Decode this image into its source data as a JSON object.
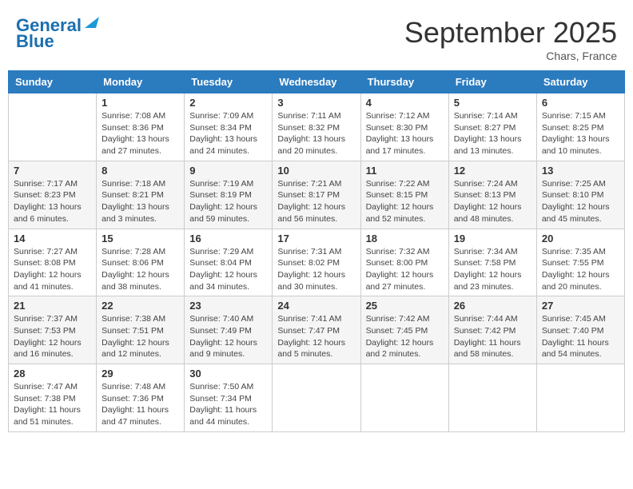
{
  "header": {
    "logo_line1": "General",
    "logo_line2": "Blue",
    "month_title": "September 2025",
    "location": "Chars, France"
  },
  "weekdays": [
    "Sunday",
    "Monday",
    "Tuesday",
    "Wednesday",
    "Thursday",
    "Friday",
    "Saturday"
  ],
  "weeks": [
    [
      {
        "day": null,
        "sunrise": null,
        "sunset": null,
        "daylight": null
      },
      {
        "day": "1",
        "sunrise": "Sunrise: 7:08 AM",
        "sunset": "Sunset: 8:36 PM",
        "daylight": "Daylight: 13 hours and 27 minutes."
      },
      {
        "day": "2",
        "sunrise": "Sunrise: 7:09 AM",
        "sunset": "Sunset: 8:34 PM",
        "daylight": "Daylight: 13 hours and 24 minutes."
      },
      {
        "day": "3",
        "sunrise": "Sunrise: 7:11 AM",
        "sunset": "Sunset: 8:32 PM",
        "daylight": "Daylight: 13 hours and 20 minutes."
      },
      {
        "day": "4",
        "sunrise": "Sunrise: 7:12 AM",
        "sunset": "Sunset: 8:30 PM",
        "daylight": "Daylight: 13 hours and 17 minutes."
      },
      {
        "day": "5",
        "sunrise": "Sunrise: 7:14 AM",
        "sunset": "Sunset: 8:27 PM",
        "daylight": "Daylight: 13 hours and 13 minutes."
      },
      {
        "day": "6",
        "sunrise": "Sunrise: 7:15 AM",
        "sunset": "Sunset: 8:25 PM",
        "daylight": "Daylight: 13 hours and 10 minutes."
      }
    ],
    [
      {
        "day": "7",
        "sunrise": "Sunrise: 7:17 AM",
        "sunset": "Sunset: 8:23 PM",
        "daylight": "Daylight: 13 hours and 6 minutes."
      },
      {
        "day": "8",
        "sunrise": "Sunrise: 7:18 AM",
        "sunset": "Sunset: 8:21 PM",
        "daylight": "Daylight: 13 hours and 3 minutes."
      },
      {
        "day": "9",
        "sunrise": "Sunrise: 7:19 AM",
        "sunset": "Sunset: 8:19 PM",
        "daylight": "Daylight: 12 hours and 59 minutes."
      },
      {
        "day": "10",
        "sunrise": "Sunrise: 7:21 AM",
        "sunset": "Sunset: 8:17 PM",
        "daylight": "Daylight: 12 hours and 56 minutes."
      },
      {
        "day": "11",
        "sunrise": "Sunrise: 7:22 AM",
        "sunset": "Sunset: 8:15 PM",
        "daylight": "Daylight: 12 hours and 52 minutes."
      },
      {
        "day": "12",
        "sunrise": "Sunrise: 7:24 AM",
        "sunset": "Sunset: 8:13 PM",
        "daylight": "Daylight: 12 hours and 48 minutes."
      },
      {
        "day": "13",
        "sunrise": "Sunrise: 7:25 AM",
        "sunset": "Sunset: 8:10 PM",
        "daylight": "Daylight: 12 hours and 45 minutes."
      }
    ],
    [
      {
        "day": "14",
        "sunrise": "Sunrise: 7:27 AM",
        "sunset": "Sunset: 8:08 PM",
        "daylight": "Daylight: 12 hours and 41 minutes."
      },
      {
        "day": "15",
        "sunrise": "Sunrise: 7:28 AM",
        "sunset": "Sunset: 8:06 PM",
        "daylight": "Daylight: 12 hours and 38 minutes."
      },
      {
        "day": "16",
        "sunrise": "Sunrise: 7:29 AM",
        "sunset": "Sunset: 8:04 PM",
        "daylight": "Daylight: 12 hours and 34 minutes."
      },
      {
        "day": "17",
        "sunrise": "Sunrise: 7:31 AM",
        "sunset": "Sunset: 8:02 PM",
        "daylight": "Daylight: 12 hours and 30 minutes."
      },
      {
        "day": "18",
        "sunrise": "Sunrise: 7:32 AM",
        "sunset": "Sunset: 8:00 PM",
        "daylight": "Daylight: 12 hours and 27 minutes."
      },
      {
        "day": "19",
        "sunrise": "Sunrise: 7:34 AM",
        "sunset": "Sunset: 7:58 PM",
        "daylight": "Daylight: 12 hours and 23 minutes."
      },
      {
        "day": "20",
        "sunrise": "Sunrise: 7:35 AM",
        "sunset": "Sunset: 7:55 PM",
        "daylight": "Daylight: 12 hours and 20 minutes."
      }
    ],
    [
      {
        "day": "21",
        "sunrise": "Sunrise: 7:37 AM",
        "sunset": "Sunset: 7:53 PM",
        "daylight": "Daylight: 12 hours and 16 minutes."
      },
      {
        "day": "22",
        "sunrise": "Sunrise: 7:38 AM",
        "sunset": "Sunset: 7:51 PM",
        "daylight": "Daylight: 12 hours and 12 minutes."
      },
      {
        "day": "23",
        "sunrise": "Sunrise: 7:40 AM",
        "sunset": "Sunset: 7:49 PM",
        "daylight": "Daylight: 12 hours and 9 minutes."
      },
      {
        "day": "24",
        "sunrise": "Sunrise: 7:41 AM",
        "sunset": "Sunset: 7:47 PM",
        "daylight": "Daylight: 12 hours and 5 minutes."
      },
      {
        "day": "25",
        "sunrise": "Sunrise: 7:42 AM",
        "sunset": "Sunset: 7:45 PM",
        "daylight": "Daylight: 12 hours and 2 minutes."
      },
      {
        "day": "26",
        "sunrise": "Sunrise: 7:44 AM",
        "sunset": "Sunset: 7:42 PM",
        "daylight": "Daylight: 11 hours and 58 minutes."
      },
      {
        "day": "27",
        "sunrise": "Sunrise: 7:45 AM",
        "sunset": "Sunset: 7:40 PM",
        "daylight": "Daylight: 11 hours and 54 minutes."
      }
    ],
    [
      {
        "day": "28",
        "sunrise": "Sunrise: 7:47 AM",
        "sunset": "Sunset: 7:38 PM",
        "daylight": "Daylight: 11 hours and 51 minutes."
      },
      {
        "day": "29",
        "sunrise": "Sunrise: 7:48 AM",
        "sunset": "Sunset: 7:36 PM",
        "daylight": "Daylight: 11 hours and 47 minutes."
      },
      {
        "day": "30",
        "sunrise": "Sunrise: 7:50 AM",
        "sunset": "Sunset: 7:34 PM",
        "daylight": "Daylight: 11 hours and 44 minutes."
      },
      {
        "day": null,
        "sunrise": null,
        "sunset": null,
        "daylight": null
      },
      {
        "day": null,
        "sunrise": null,
        "sunset": null,
        "daylight": null
      },
      {
        "day": null,
        "sunrise": null,
        "sunset": null,
        "daylight": null
      },
      {
        "day": null,
        "sunrise": null,
        "sunset": null,
        "daylight": null
      }
    ]
  ]
}
